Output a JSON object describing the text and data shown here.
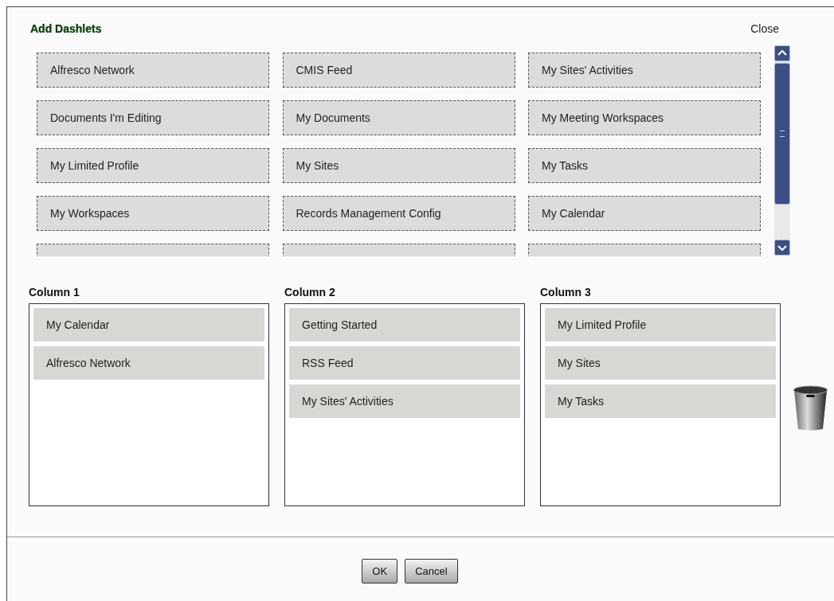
{
  "dialog": {
    "title": "Add Dashlets",
    "close": "Close"
  },
  "available": [
    {
      "label": "Alfresco Network"
    },
    {
      "label": "CMIS Feed"
    },
    {
      "label": "My Sites' Activities"
    },
    {
      "label": "Documents I'm Editing"
    },
    {
      "label": "My Documents"
    },
    {
      "label": "My Meeting Workspaces"
    },
    {
      "label": "My Limited Profile"
    },
    {
      "label": "My Sites"
    },
    {
      "label": "My Tasks"
    },
    {
      "label": "My Workspaces"
    },
    {
      "label": "Records Management Config"
    },
    {
      "label": "My Calendar"
    },
    {
      "kind": "cut"
    },
    {
      "kind": "cut"
    },
    {
      "kind": "cut"
    }
  ],
  "columns": [
    {
      "title": "Column 1",
      "dashlets": [
        "My Calendar",
        "Alfresco Network"
      ]
    },
    {
      "title": "Column 2",
      "dashlets": [
        "Getting Started",
        "RSS Feed",
        "My Sites' Activities"
      ]
    },
    {
      "title": "Column 3",
      "dashlets": [
        "My Limited Profile",
        "My Sites",
        "My Tasks"
      ]
    }
  ],
  "buttons": [
    "OK",
    "Cancel"
  ]
}
